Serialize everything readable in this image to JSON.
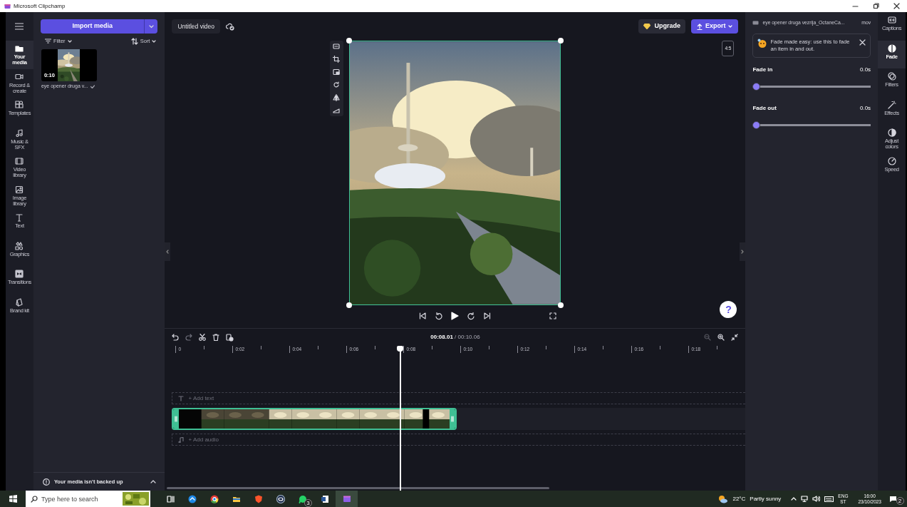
{
  "window": {
    "title": "Microsoft Clipchamp"
  },
  "left_nav": {
    "items": [
      {
        "label": "Your media",
        "selected": true
      },
      {
        "label": "Record & create",
        "selected": false
      },
      {
        "label": "Templates",
        "selected": false
      },
      {
        "label": "Music & SFX",
        "selected": false
      },
      {
        "label": "Video library",
        "selected": false
      },
      {
        "label": "Image library",
        "selected": false
      },
      {
        "label": "Text",
        "selected": false
      },
      {
        "label": "Graphics",
        "selected": false
      },
      {
        "label": "Transitions",
        "selected": false
      },
      {
        "label": "Brand kit",
        "selected": false
      }
    ]
  },
  "media_panel": {
    "import_button": "Import media",
    "filter": "Filter",
    "sort": "Sort",
    "items": [
      {
        "duration": "0:10",
        "name": "eye opener druga v..."
      }
    ],
    "backup_notice": "Your media isn't backed up"
  },
  "editor": {
    "project_title": "Untitled video",
    "upgrade_button": "Upgrade",
    "export_button": "Export",
    "aspect_ratio": "4:5",
    "help": "?"
  },
  "timeline": {
    "current_time": "00:08.01",
    "separator": "/",
    "total_time": "00:10.06",
    "ruler": [
      "0",
      "0:02",
      "0:04",
      "0:06",
      "0:08",
      "0:10",
      "0:12",
      "0:14",
      "0:16",
      "0:18"
    ],
    "text_track": "+ Add text",
    "audio_track": "+ Add audio"
  },
  "properties": {
    "file_name": "eye opener druga vezrija_OctaneCa...",
    "file_type": "mov",
    "tip": "Fade made easy: use this to fade an item in and out.",
    "sliders": [
      {
        "label": "Fade in",
        "value": "0.0s",
        "level": 0
      },
      {
        "label": "Fade out",
        "value": "0.0s",
        "level": 0
      }
    ]
  },
  "right_nav": {
    "items": [
      {
        "label": "Captions",
        "selected": false
      },
      {
        "label": "Fade",
        "selected": true
      },
      {
        "label": "Filters",
        "selected": false
      },
      {
        "label": "Effects",
        "selected": false
      },
      {
        "label": "Adjust colors",
        "selected": false
      },
      {
        "label": "Speed",
        "selected": false
      }
    ]
  },
  "taskbar": {
    "search_placeholder": "Type here to search",
    "apps": [
      {
        "selected": false
      },
      {
        "selected": false
      },
      {
        "selected": false
      },
      {
        "selected": false
      },
      {
        "selected": false
      },
      {
        "selected": false
      },
      {
        "selected": false,
        "badge": "3"
      },
      {
        "selected": false
      },
      {
        "selected": true
      }
    ],
    "temperature": "22°C",
    "weather": "Partly sunny",
    "language": "ENG",
    "layout": "ST",
    "time": "16:00",
    "date": "23/10/2023",
    "notifications": "2"
  }
}
